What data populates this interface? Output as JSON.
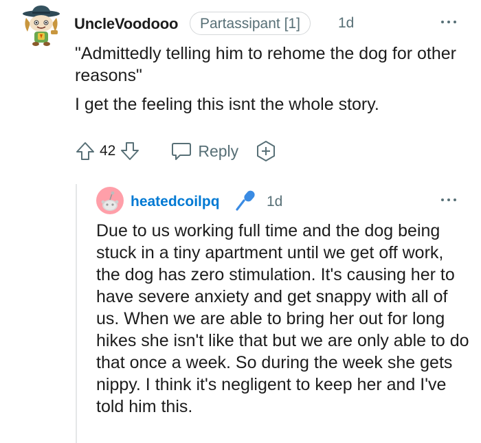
{
  "top_comment": {
    "username": "UncleVoodooo",
    "flair": "Partassipant [1]",
    "time": "1d",
    "body_quote": "\"Admittedly telling him to rehome the dog for other reasons\"",
    "body_text": "I get the feeling this isnt the whole story.",
    "score": "42",
    "reply_label": "Reply",
    "icons": {
      "avatar": "avatar-snoo-cowboy-icon",
      "more": "more-options-icon",
      "upvote": "upvote-arrow-icon",
      "downvote": "downvote-arrow-icon",
      "reply": "reply-bubble-icon",
      "award": "award-plus-icon"
    }
  },
  "reply_comment": {
    "username": "heatedcoilpq",
    "time": "1d",
    "body": "Due to us working full time and the dog being stuck in a tiny apartment until we get off work, the dog has zero stimulation. It's causing her to have severe anxiety and get snappy with all of us. When we are able to bring her out for long hikes she isn't like that but we are only able to do that once a week. So during the week she gets nippy. I think it's negligent to keep her and I've told him this.",
    "icons": {
      "avatar": "avatar-default-snoo-icon",
      "mic": "microphone-icon",
      "more": "more-options-icon"
    }
  },
  "colors": {
    "username_link": "#0079d3",
    "meta_gray": "#576f76",
    "text": "#1c1c1c",
    "thread_line": "#e5e7e8",
    "avatar2_bg": "#ff9fa9",
    "mic": "#3a8be3"
  }
}
